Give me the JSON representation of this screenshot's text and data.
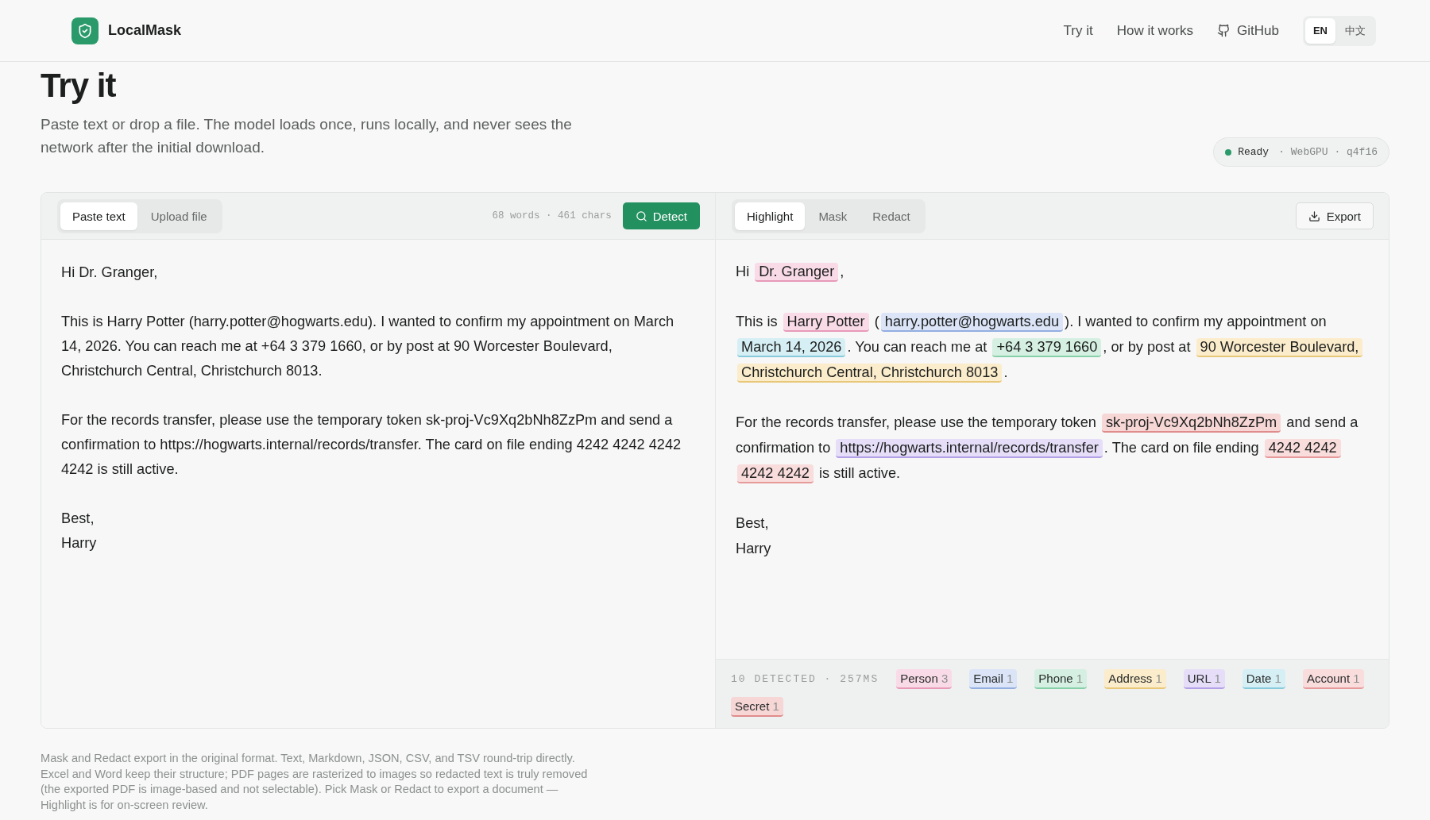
{
  "nav": {
    "brand": "LocalMask",
    "links": [
      "Try it",
      "How it works",
      "GitHub"
    ],
    "languages": [
      {
        "label": "EN",
        "selected": true
      },
      {
        "label": "中文",
        "selected": false
      }
    ]
  },
  "hero": {
    "title": "Try it",
    "subtitle": "Paste text or drop a file. The model loads once, runs locally, and never sees the network after the initial download.",
    "status": {
      "label": "Ready",
      "ready": true,
      "details": "· WebGPU · q4f16"
    }
  },
  "input": {
    "tabs": [
      {
        "label": "Paste text",
        "selected": true
      },
      {
        "label": "Upload file",
        "selected": false
      }
    ],
    "counts": "68 words · 461 chars",
    "detect": "Detect",
    "text": "Hi Dr. Granger,\n\nThis is Harry Potter (harry.potter@hogwarts.edu). I wanted to confirm my appointment on March 14, 2026. You can reach me at +64 3 379 1660, or by post at 90 Worcester Boulevard, Christchurch Central, Christchurch 8013.\n\nFor the records transfer, please use the temporary token sk-proj-Vc9Xq2bNh8ZzPm and send a confirmation to https://hogwarts.internal/records/transfer. The card on file ending 4242 4242 4242 4242 is still active.\n\nBest,\nHarry"
  },
  "output": {
    "tabs": [
      {
        "label": "Highlight",
        "selected": true
      },
      {
        "label": "Mask",
        "selected": false
      },
      {
        "label": "Redact",
        "selected": false
      }
    ],
    "export": "Export",
    "paragraphs": [
      [
        {
          "text": "Hi ",
          "kind": "plain"
        },
        {
          "text": "Dr. Granger",
          "kind": "person"
        },
        {
          "text": ",",
          "kind": "plain"
        }
      ],
      [
        {
          "text": "This is ",
          "kind": "plain"
        },
        {
          "text": "Harry Potter",
          "kind": "person"
        },
        {
          "text": " (",
          "kind": "plain"
        },
        {
          "text": "harry.potter@hogwarts.edu",
          "kind": "email"
        },
        {
          "text": "). I wanted to confirm my appointment on ",
          "kind": "plain"
        },
        {
          "text": "March 14, 2026",
          "kind": "date"
        },
        {
          "text": ". You can reach me at ",
          "kind": "plain"
        },
        {
          "text": "+64 3 379 1660",
          "kind": "phone"
        },
        {
          "text": ", or by post at ",
          "kind": "plain"
        },
        {
          "text": "90 Worcester Boulevard, Christchurch Central, Christchurch 8013",
          "kind": "address"
        },
        {
          "text": ".",
          "kind": "plain"
        }
      ],
      [
        {
          "text": "For the records transfer, please use the temporary token ",
          "kind": "plain"
        },
        {
          "text": "sk-proj-Vc9Xq2bNh8ZzPm",
          "kind": "secret"
        },
        {
          "text": " and send a confirmation to ",
          "kind": "plain"
        },
        {
          "text": "https://hogwarts.internal/records/transfer",
          "kind": "url"
        },
        {
          "text": ". The card on file ending ",
          "kind": "plain"
        },
        {
          "text": "4242 4242 4242 4242",
          "kind": "account"
        },
        {
          "text": " is still active.",
          "kind": "plain"
        }
      ],
      [
        {
          "text": "Best,",
          "kind": "plain"
        }
      ],
      [
        {
          "text": "Harry",
          "kind": "plain"
        }
      ]
    ],
    "summary": "10 DETECTED · 257MS",
    "chips": [
      {
        "label": "Person",
        "count": "3",
        "kind": "person"
      },
      {
        "label": "Email",
        "count": "1",
        "kind": "email"
      },
      {
        "label": "Phone",
        "count": "1",
        "kind": "phone"
      },
      {
        "label": "Address",
        "count": "1",
        "kind": "address"
      },
      {
        "label": "URL",
        "count": "1",
        "kind": "url"
      },
      {
        "label": "Date",
        "count": "1",
        "kind": "date"
      },
      {
        "label": "Account",
        "count": "1",
        "kind": "account"
      },
      {
        "label": "Secret",
        "count": "1",
        "kind": "secret"
      }
    ]
  },
  "footnote": "Mask and Redact export in the original format. Text, Markdown, JSON, CSV, and TSV round-trip directly. Excel and Word keep their structure; PDF pages are rasterized to images so redacted text is truly removed (the exported PDF is image-based and not selectable). Pick Mask or Redact to export a document — Highlight is for on-screen review."
}
